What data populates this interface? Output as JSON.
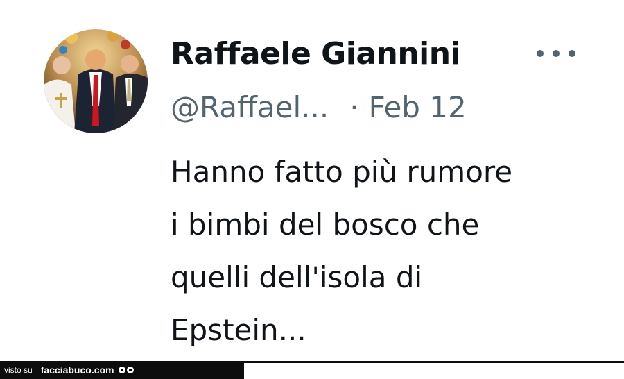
{
  "tweet": {
    "author_name": "Raffaele Giannini",
    "handle": "@Raffael...",
    "separator": "·",
    "date": "Feb 12",
    "text": "Hanno fatto più rumore\ni bimbi del bosco che\nquelli dell'isola di\nEpstein...",
    "more_icon": "more-horizontal-icon",
    "avatar": "profile-photo"
  },
  "watermark": {
    "prefix": "visto su",
    "site": "facciabuco.com",
    "logo_icon": "eyes-logo-icon"
  },
  "colors": {
    "text_primary": "#0f1419",
    "text_secondary": "#536471",
    "footer_bg": "#0d0d0d"
  }
}
